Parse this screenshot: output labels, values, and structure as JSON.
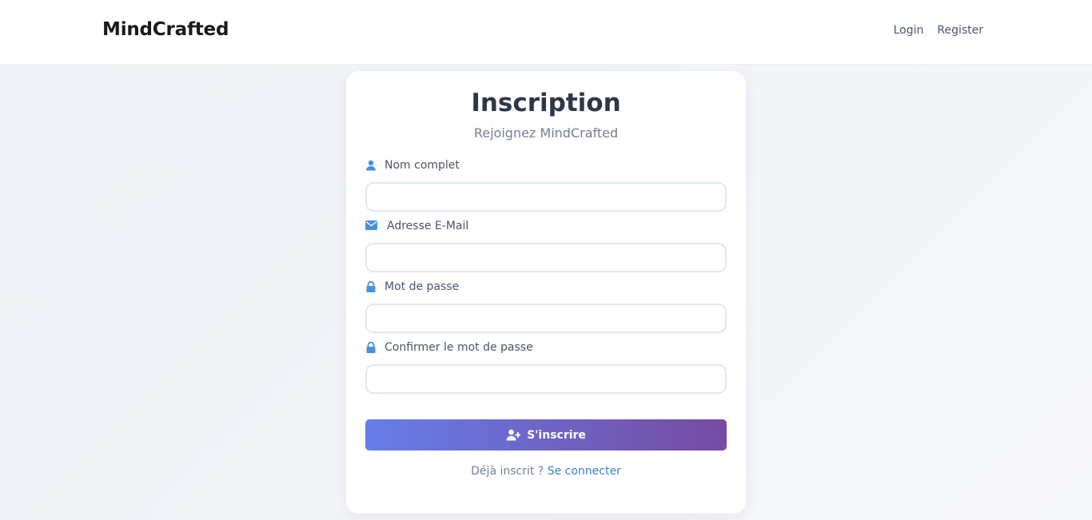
{
  "navbar": {
    "brand": "MindCrafted",
    "links": [
      {
        "label": "Login"
      },
      {
        "label": "Register"
      }
    ]
  },
  "form": {
    "title": "Inscription",
    "subtitle": "Rejoignez MindCrafted",
    "fields": [
      {
        "label": "Nom complet",
        "icon": "user-icon",
        "value": "",
        "placeholder": ""
      },
      {
        "label": "Adresse E-Mail",
        "icon": "envelope-icon",
        "value": "",
        "placeholder": ""
      },
      {
        "label": "Mot de passe",
        "icon": "lock-icon",
        "value": "",
        "placeholder": ""
      },
      {
        "label": "Confirmer le mot de passe",
        "icon": "lock-icon",
        "value": "",
        "placeholder": ""
      }
    ],
    "submit_label": "S'inscrire",
    "submit_icon": "user-plus-icon",
    "footer_prefix": "Déjà inscrit ? ",
    "footer_link": "Se connecter"
  },
  "colors": {
    "accent_icon": "#4a90d9",
    "button_gradient_start": "#667eea",
    "button_gradient_end": "#764ba2",
    "link": "#3b82c4"
  }
}
